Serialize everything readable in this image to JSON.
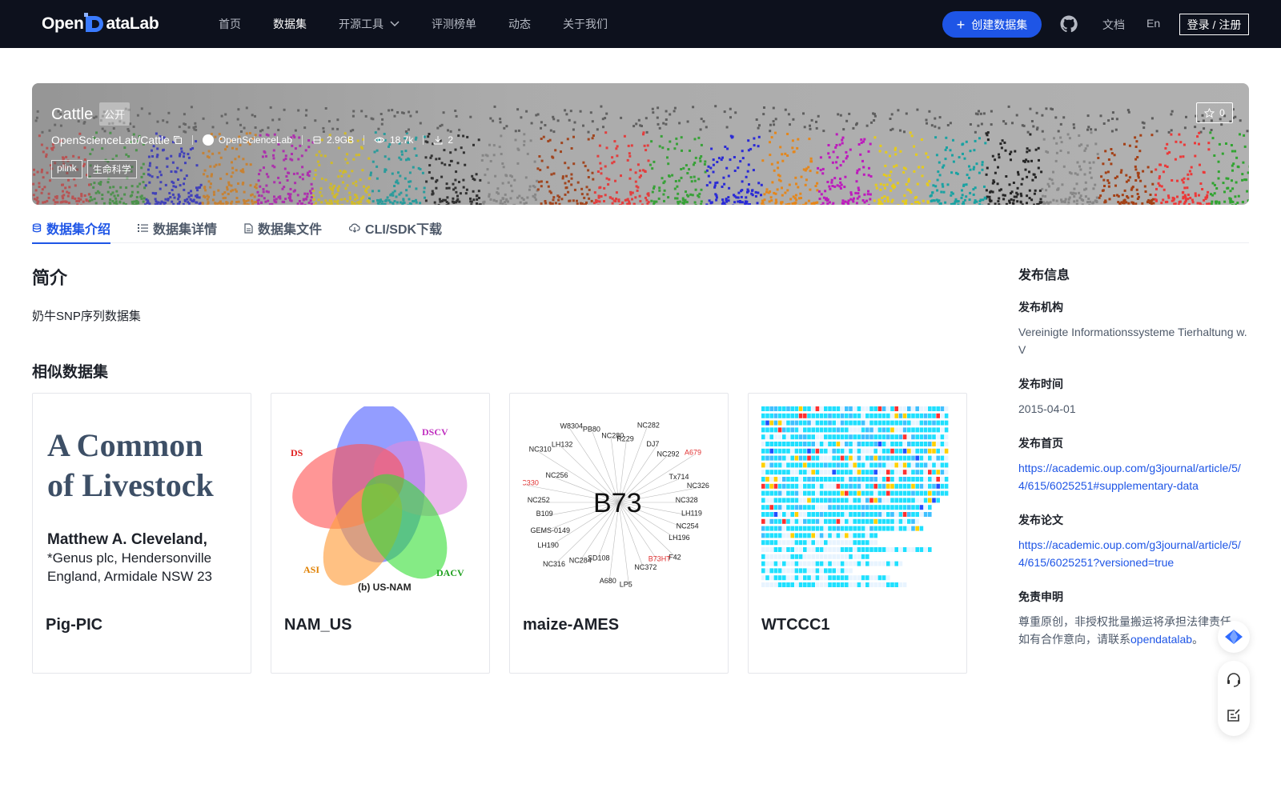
{
  "nav": {
    "logo_left": "Open",
    "logo_right": "ataLab",
    "items": [
      {
        "label": "首页"
      },
      {
        "label": "数据集"
      },
      {
        "label": "开源工具"
      },
      {
        "label": "评测榜单"
      },
      {
        "label": "动态"
      },
      {
        "label": "关于我们"
      }
    ],
    "create_label": "创建数据集",
    "docs_label": "文档",
    "lang_label": "En",
    "login_label": "登录 / 注册"
  },
  "dataset": {
    "title": "Cattle",
    "visibility": "公开",
    "repo": "OpenScienceLab/Cattle",
    "org": "OpenScienceLab",
    "size": "2.9GB",
    "views": "18.7k",
    "downloads": "2",
    "tags": [
      "plink",
      "生命科学"
    ],
    "stars": "0"
  },
  "tabs": [
    {
      "label": "数据集介绍"
    },
    {
      "label": "数据集详情"
    },
    {
      "label": "数据集文件"
    },
    {
      "label": "CLI/SDK下载"
    }
  ],
  "main": {
    "intro_heading": "简介",
    "intro_text": "奶牛SNP序列数据集",
    "similar_heading": "相似数据集",
    "cards": [
      {
        "name": "Pig-PIC",
        "thumb_lines": [
          "A Common",
          "of Livestock",
          "Matthew A. Cleveland,",
          "*Genus plc, Hendersonville",
          "England, Armidale NSW 23"
        ]
      },
      {
        "name": "NAM_US",
        "thumb_caption": "(b) US-NAM",
        "thumb_labels": [
          "DS",
          "DSCV",
          "ASI",
          "DACV"
        ]
      },
      {
        "name": "maize-AMES",
        "thumb_center": "B73"
      },
      {
        "name": "WTCCC1"
      }
    ]
  },
  "side": {
    "heading": "发布信息",
    "org_label": "发布机构",
    "org_value": "Vereinigte Informationssysteme Tierhaltung w.V",
    "date_label": "发布时间",
    "date_value": "2015-04-01",
    "home_label": "发布首页",
    "home_value": "https://academic.oup.com/g3journal/article/5/4/615/6025251#supplementary-data",
    "paper_label": "发布论文",
    "paper_value": "https://academic.oup.com/g3journal/article/5/4/615/6025251?versioned=true",
    "disclaimer_label": "免责申明",
    "disclaimer_text": "尊重原创，非授权批量搬运将承担法律责任。如有合作意向，请联系",
    "disclaimer_link": "opendatalab",
    "disclaimer_end": "。"
  },
  "colors": {
    "nav_bg": "#0d111d",
    "accent": "#1e55e6",
    "text": "#1d2129",
    "muted": "#4e5969"
  }
}
